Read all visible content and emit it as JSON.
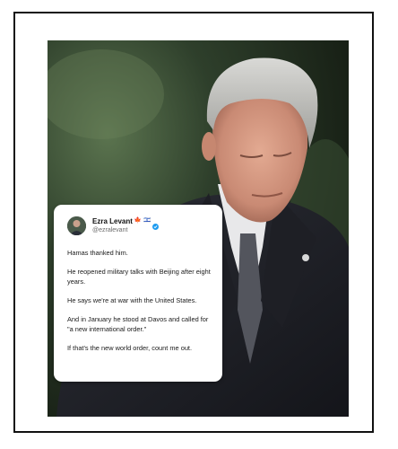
{
  "tweet": {
    "name": "Ezra Levant",
    "name_emojis": [
      "🍁",
      "🇮🇱"
    ],
    "handle": "@ezralevant",
    "verified_color": "#1d9bf0",
    "paragraphs": [
      "Hamas thanked him.",
      "He reopened military talks with Beijing after eight years.",
      "He says we're at war with the United States.",
      "And in January he stood at Davos and called for \"a new international order.\"",
      "If that's the new world order, count me out."
    ]
  },
  "colors": {
    "background": "#ffffff",
    "frame_border": "#111111",
    "card": "#ffffff"
  }
}
